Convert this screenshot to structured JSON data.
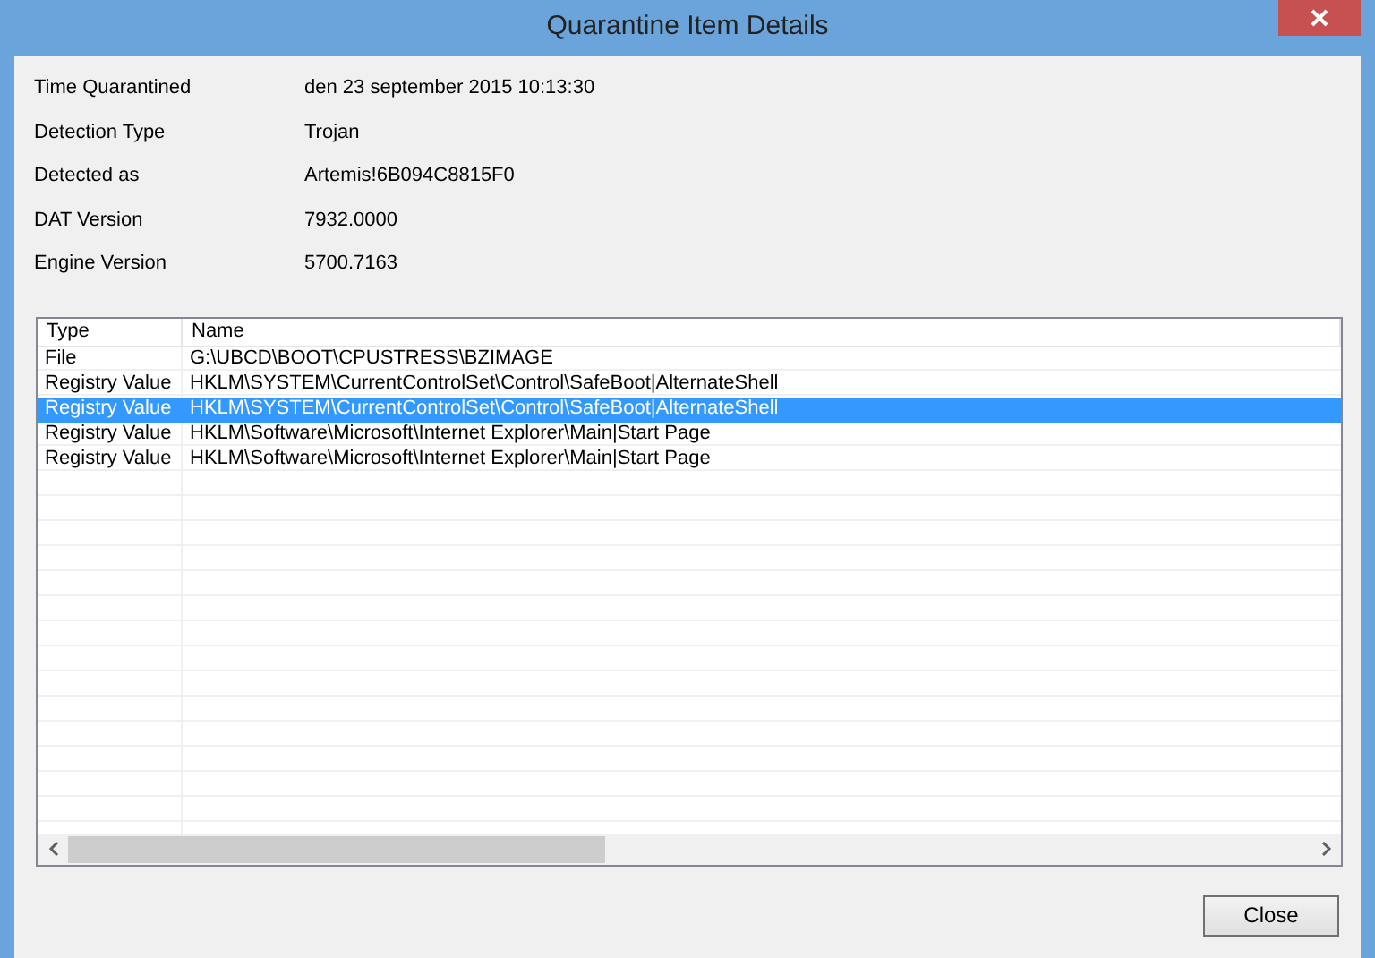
{
  "window": {
    "title": "Quarantine Item Details"
  },
  "details": [
    {
      "label": "Time Quarantined",
      "value": "den 23 september 2015 10:13:30"
    },
    {
      "label": "Detection Type",
      "value": "Trojan"
    },
    {
      "label": "Detected as",
      "value": "Artemis!6B094C8815F0"
    },
    {
      "label": "DAT Version",
      "value": "7932.0000"
    },
    {
      "label": "Engine Version",
      "value": "5700.7163"
    }
  ],
  "table": {
    "columns": [
      "Type",
      "Name"
    ],
    "rows": [
      {
        "type": "File",
        "name": "G:\\UBCD\\BOOT\\CPUSTRESS\\BZIMAGE",
        "selected": false
      },
      {
        "type": "Registry Value",
        "name": "HKLM\\SYSTEM\\CurrentControlSet\\Control\\SafeBoot|AlternateShell",
        "selected": false
      },
      {
        "type": "Registry Value",
        "name": "HKLM\\SYSTEM\\CurrentControlSet\\Control\\SafeBoot|AlternateShell",
        "selected": true
      },
      {
        "type": "Registry Value",
        "name": "HKLM\\Software\\Microsoft\\Internet Explorer\\Main|Start Page",
        "selected": false
      },
      {
        "type": "Registry Value",
        "name": "HKLM\\Software\\Microsoft\\Internet Explorer\\Main|Start Page",
        "selected": false
      }
    ]
  },
  "buttons": [
    "Close"
  ]
}
